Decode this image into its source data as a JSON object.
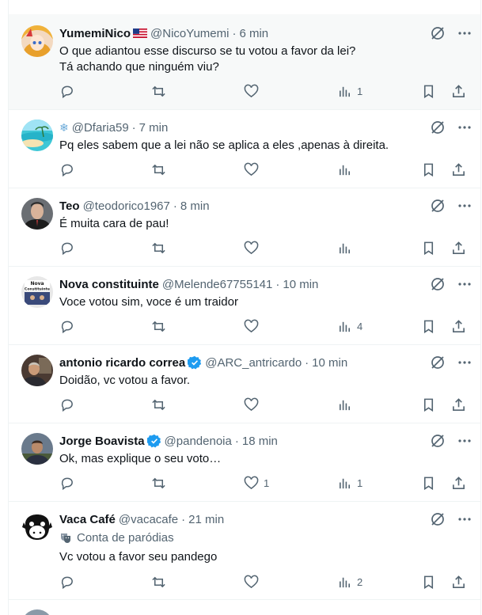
{
  "tweets": [
    {
      "name": "YumemiNico",
      "has_flag": true,
      "handle": "@NicoYumemi",
      "time": "6 min",
      "text": [
        "O que adiantou esse discurso se tu votou a favor da lei?",
        "Tá achando que ninguém viu?"
      ],
      "likes": "",
      "views": "1"
    },
    {
      "name": "",
      "prefix_icon": "snowflake-icon",
      "handle": "@Dfaria59",
      "time": "7 min",
      "text": [
        "Pq eles sabem que a lei não se aplica a eles ,apenas à direita."
      ],
      "likes": "",
      "views": ""
    },
    {
      "name": "Teo",
      "handle": "@teodorico1967",
      "time": "8 min",
      "text": [
        "É muita cara de pau!"
      ],
      "likes": "",
      "views": ""
    },
    {
      "name": "Nova constituinte",
      "handle": "@Melende67755141",
      "time": "10 min",
      "text": [
        "Voce votou sim, voce é um traidor"
      ],
      "likes": "",
      "views": "4"
    },
    {
      "name": "antonio ricardo correa",
      "verified": true,
      "handle": "@ARC_antricardo",
      "time": "10 min",
      "text": [
        "Doidão, vc votou a favor."
      ],
      "likes": "",
      "views": ""
    },
    {
      "name": "Jorge Boavista",
      "verified": true,
      "handle": "@pandenoia",
      "time": "18 min",
      "text": [
        "Ok, mas explique o seu voto…"
      ],
      "likes": "1",
      "views": "1"
    },
    {
      "name": "Vaca Café",
      "handle": "@vacacafe",
      "time": "21 min",
      "parody_label": "Conta de paródias",
      "text": [
        "Vc votou a favor seu pandego"
      ],
      "likes": "",
      "views": "2"
    }
  ],
  "dot": "·",
  "avatar_texts": {
    "nova": "Nova Constituinte"
  },
  "colors": {
    "verified": "#1d9bf0",
    "secondary": "#536471",
    "border": "#eff3f4"
  }
}
